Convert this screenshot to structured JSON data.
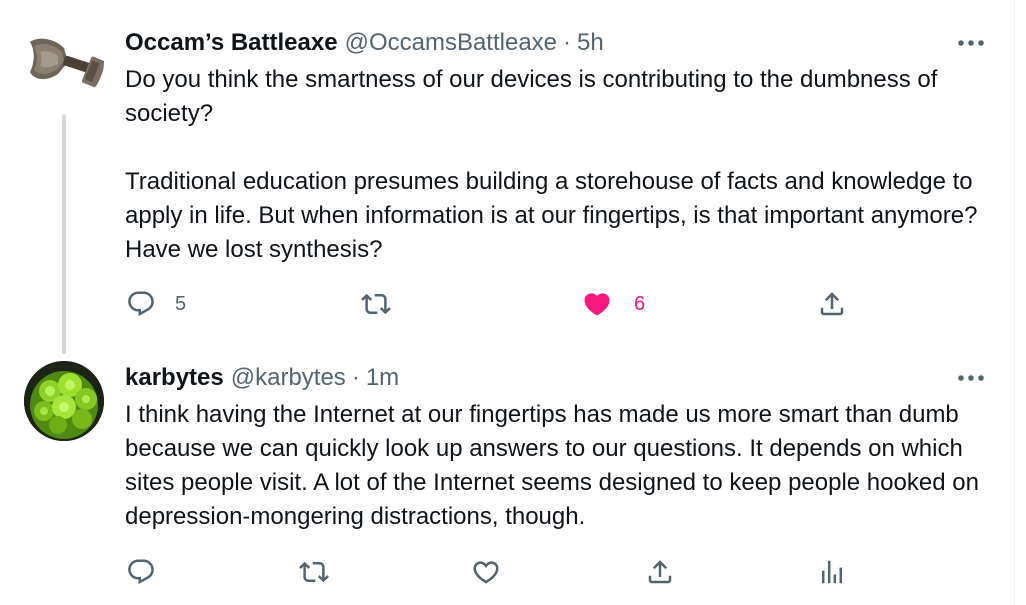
{
  "colors": {
    "text": "#0f1419",
    "muted": "#536471",
    "like": "#f91880",
    "thread_line": "#cfd9de"
  },
  "tweets": [
    {
      "avatar_icon": "battleaxe-avatar-icon",
      "name": "Occam’s Battleaxe",
      "handle": "@OccamsBattleaxe",
      "separator": "·",
      "time": "5h",
      "paragraphs": [
        "Do you think the smartness of our devices is contributing to the dumbness of society?",
        "Traditional education presumes building a storehouse of facts and knowledge to apply in life. But when information is at our fingertips, is that important anymore? Have we lost synthesis?"
      ],
      "actions": {
        "reply_icon": "reply-icon",
        "reply_count": "5",
        "retweet_icon": "retweet-icon",
        "like_icon": "heart-filled-icon",
        "like_count": "6",
        "liked": true,
        "share_icon": "share-icon"
      }
    },
    {
      "avatar_icon": "romanesco-avatar-icon",
      "name": "karbytes",
      "handle": "@karbytes",
      "separator": "·",
      "time": "1m",
      "paragraphs": [
        "I think having the Internet at our fingertips has made us more smart than dumb because we can quickly look up answers to our questions. It depends on which sites people visit. A lot of the Internet seems designed to keep people hooked on depression-mongering distractions, though."
      ],
      "actions": {
        "reply_icon": "reply-icon",
        "retweet_icon": "retweet-icon",
        "like_icon": "heart-outline-icon",
        "share_icon": "share-icon",
        "analytics_icon": "analytics-icon"
      }
    }
  ]
}
